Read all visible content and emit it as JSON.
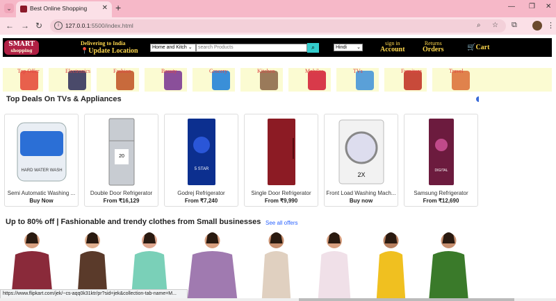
{
  "browser": {
    "tab_title": "Best Online Shopping",
    "url_host": "127.0.0.1",
    "url_rest": ":5500/index.html"
  },
  "header": {
    "logo_text": "SMART",
    "logo_sub": "shopping",
    "deliver_line1": "Delivering to India",
    "deliver_line2": "Update Location",
    "category_select": "Home and Kitch",
    "search_placeholder": "search Products",
    "language": "Hindi",
    "signin_small": "sign in",
    "signin_big": "Account",
    "returns_small": "Returns",
    "returns_big": "Orders",
    "cart": "Cart"
  },
  "categories": [
    {
      "label": "Top Offer",
      "color": "#e8604c"
    },
    {
      "label": "Electronics",
      "color": "#4a4a6a"
    },
    {
      "label": "Fashion",
      "color": "#c86a3c"
    },
    {
      "label": "Beauty",
      "color": "#8a4f9a"
    },
    {
      "label": "Grocery",
      "color": "#3a8fd8"
    },
    {
      "label": "Kitchen",
      "color": "#9a7a5a"
    },
    {
      "label": "Mobiles",
      "color": "#d83a4a"
    },
    {
      "label": "TVs",
      "color": "#5aa0d8"
    },
    {
      "label": "Furniture",
      "color": "#c84a3a"
    },
    {
      "label": "Travel",
      "color": "#e0824c"
    }
  ],
  "deals": {
    "title": "Top Deals On TVs & Appliances",
    "items": [
      {
        "name": "Semi Automatic Washing ...",
        "price": "Buy Now"
      },
      {
        "name": "Double Door Refrigerator",
        "price": "From ₹16,129"
      },
      {
        "name": "Godrej Refrigerator",
        "price": "From ₹7,240"
      },
      {
        "name": "Single Door Refrigerator",
        "price": "From ₹9,990"
      },
      {
        "name": "Front Load Washing Mach...",
        "price": "Buy now"
      },
      {
        "name": "Samsung Refrigerator",
        "price": "From ₹12,690"
      }
    ]
  },
  "fashion": {
    "title": "Up to 80% off | Fashionable and trendy clothes from Small businesses",
    "see_all": "See all offers"
  },
  "status_url": "https://www.flipkart.com/jek/~cs-aqq0k31ktr/pr?sid=jek&collection-tab-name=M..."
}
